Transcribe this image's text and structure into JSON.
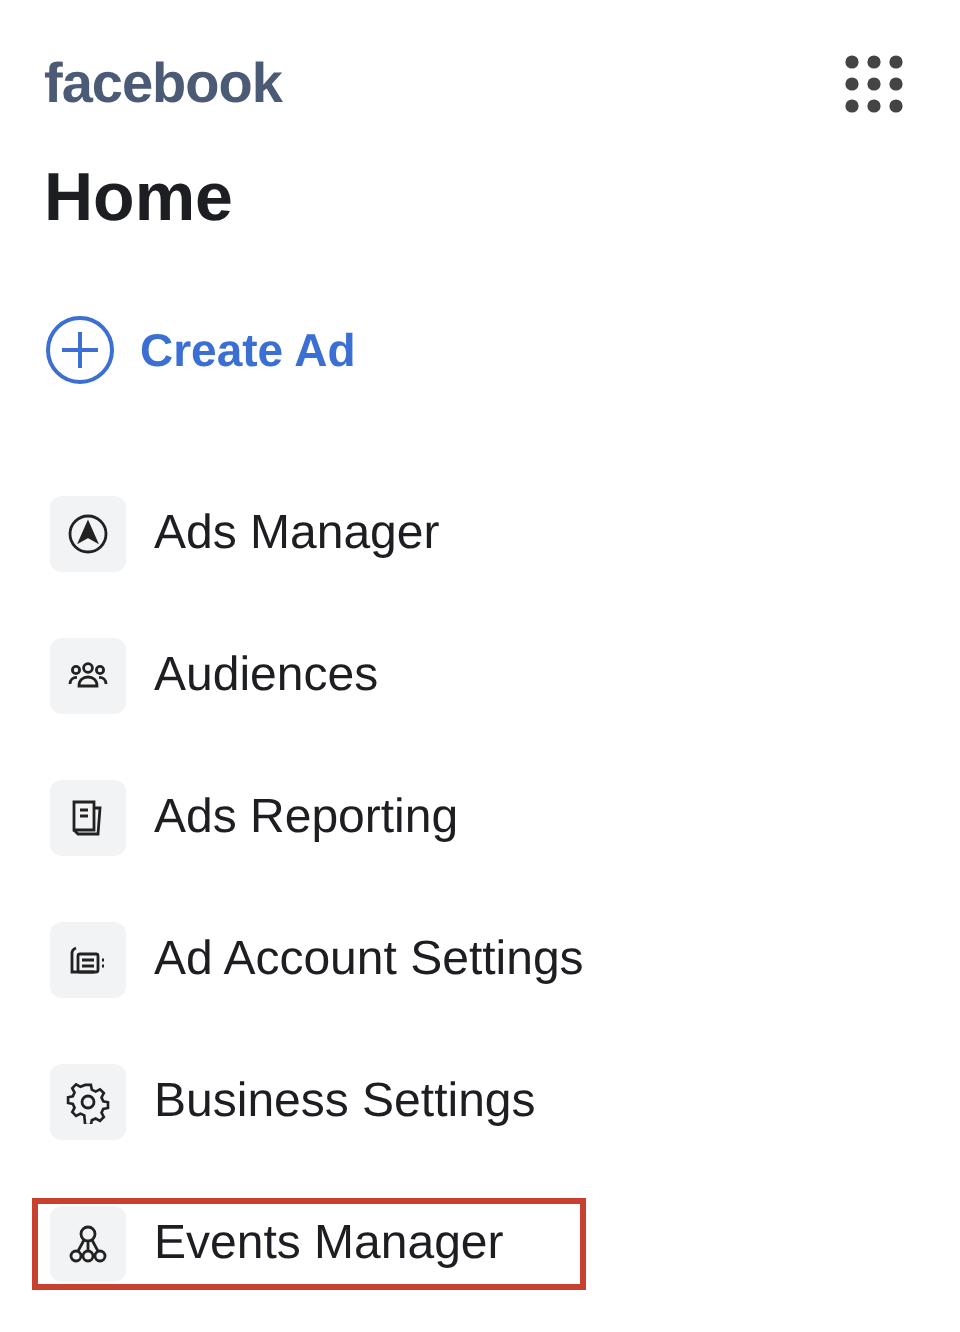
{
  "header": {
    "logo": "facebook"
  },
  "title": "Home",
  "create_button": {
    "label": "Create Ad"
  },
  "menu": [
    {
      "kind": "compass",
      "label": "Ads Manager",
      "highlighted": false
    },
    {
      "kind": "people",
      "label": "Audiences",
      "highlighted": false
    },
    {
      "kind": "report",
      "label": "Ads Reporting",
      "highlighted": false
    },
    {
      "kind": "account",
      "label": "Ad Account Settings",
      "highlighted": false
    },
    {
      "kind": "gear",
      "label": "Business Settings",
      "highlighted": false
    },
    {
      "kind": "nodes",
      "label": "Events Manager",
      "highlighted": true
    }
  ]
}
